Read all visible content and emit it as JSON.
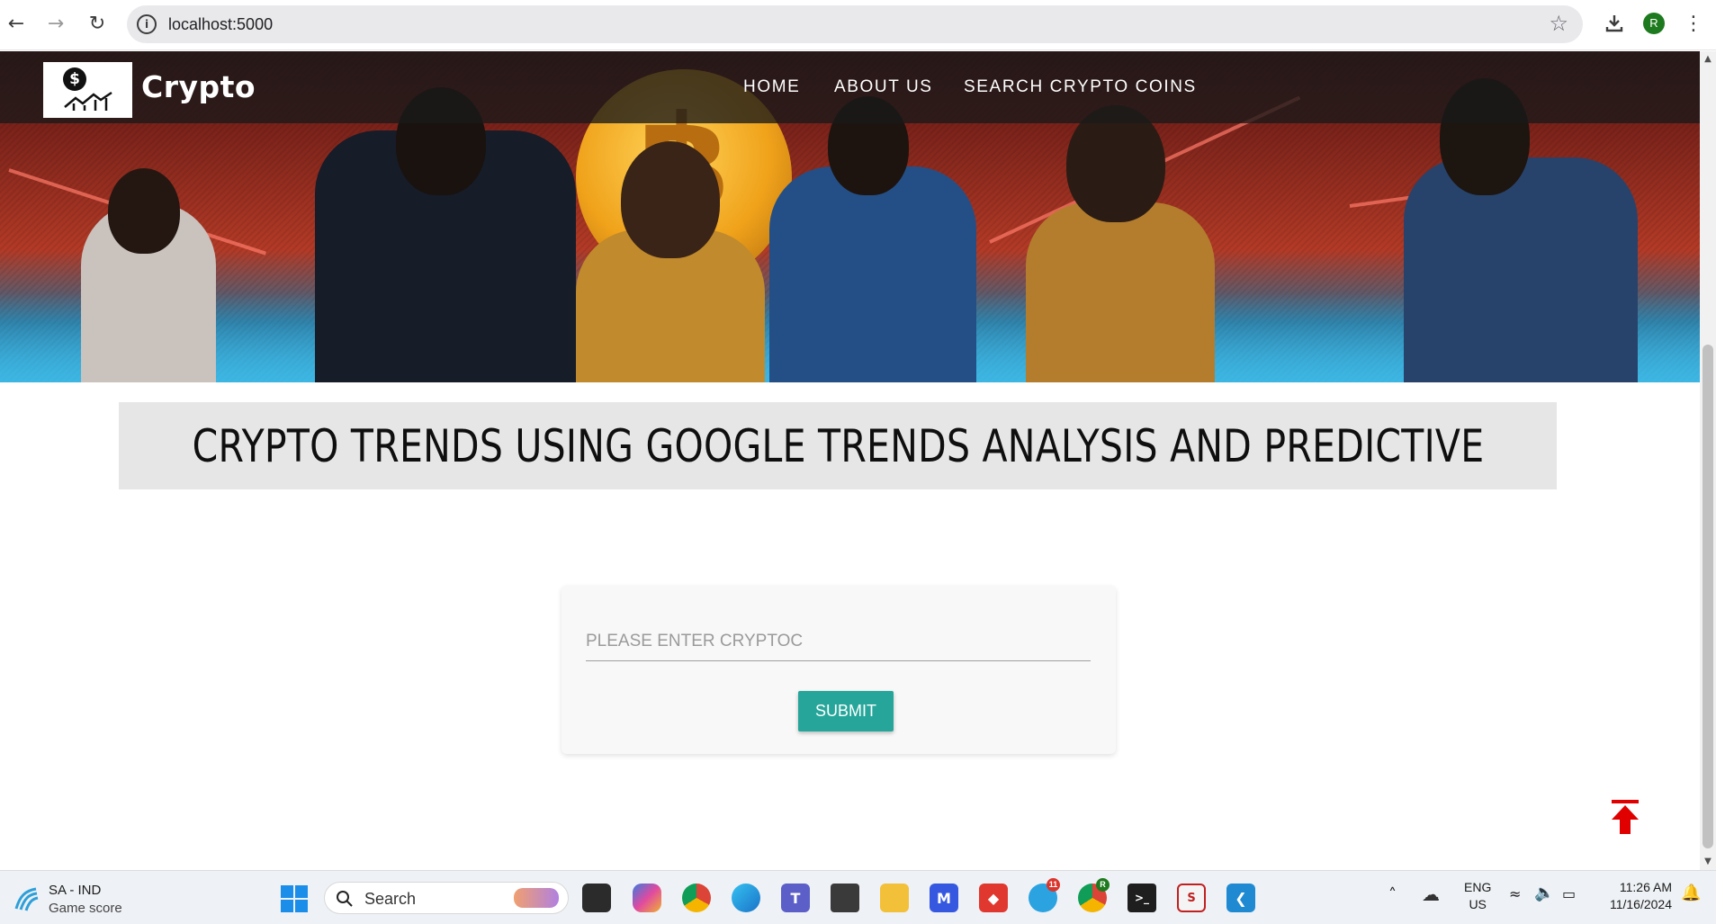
{
  "browser": {
    "url": "localhost:5000",
    "profile_initial": "R",
    "icons": [
      "back-icon",
      "forward-icon",
      "reload-icon",
      "info-icon",
      "star-icon",
      "download-icon",
      "menu-dots-icon"
    ]
  },
  "site": {
    "brand": "Crypto",
    "nav": [
      {
        "label": "HOME"
      },
      {
        "label": "ABOUT US"
      },
      {
        "label": "SEARCH CRYPTO COINS"
      }
    ],
    "title": "CRYPTO TRENDS USING GOOGLE TRENDS ANALYSIS AND PREDICTIVE",
    "form": {
      "placeholder": "PLEASE ENTER CRYPTOC",
      "submit_label": "SUBMIT"
    },
    "colors": {
      "accent": "#26a69a",
      "nav_bg": "#191919",
      "to_top": "#e00000"
    }
  },
  "taskbar": {
    "weather_title": "SA - IND",
    "weather_sub": "Game score",
    "search_placeholder": "Search",
    "telegram_badge": "11",
    "chrome_profile": "R",
    "lang_top": "ENG",
    "lang_bottom": "US",
    "time": "11:26 AM",
    "date": "11/16/2024"
  }
}
